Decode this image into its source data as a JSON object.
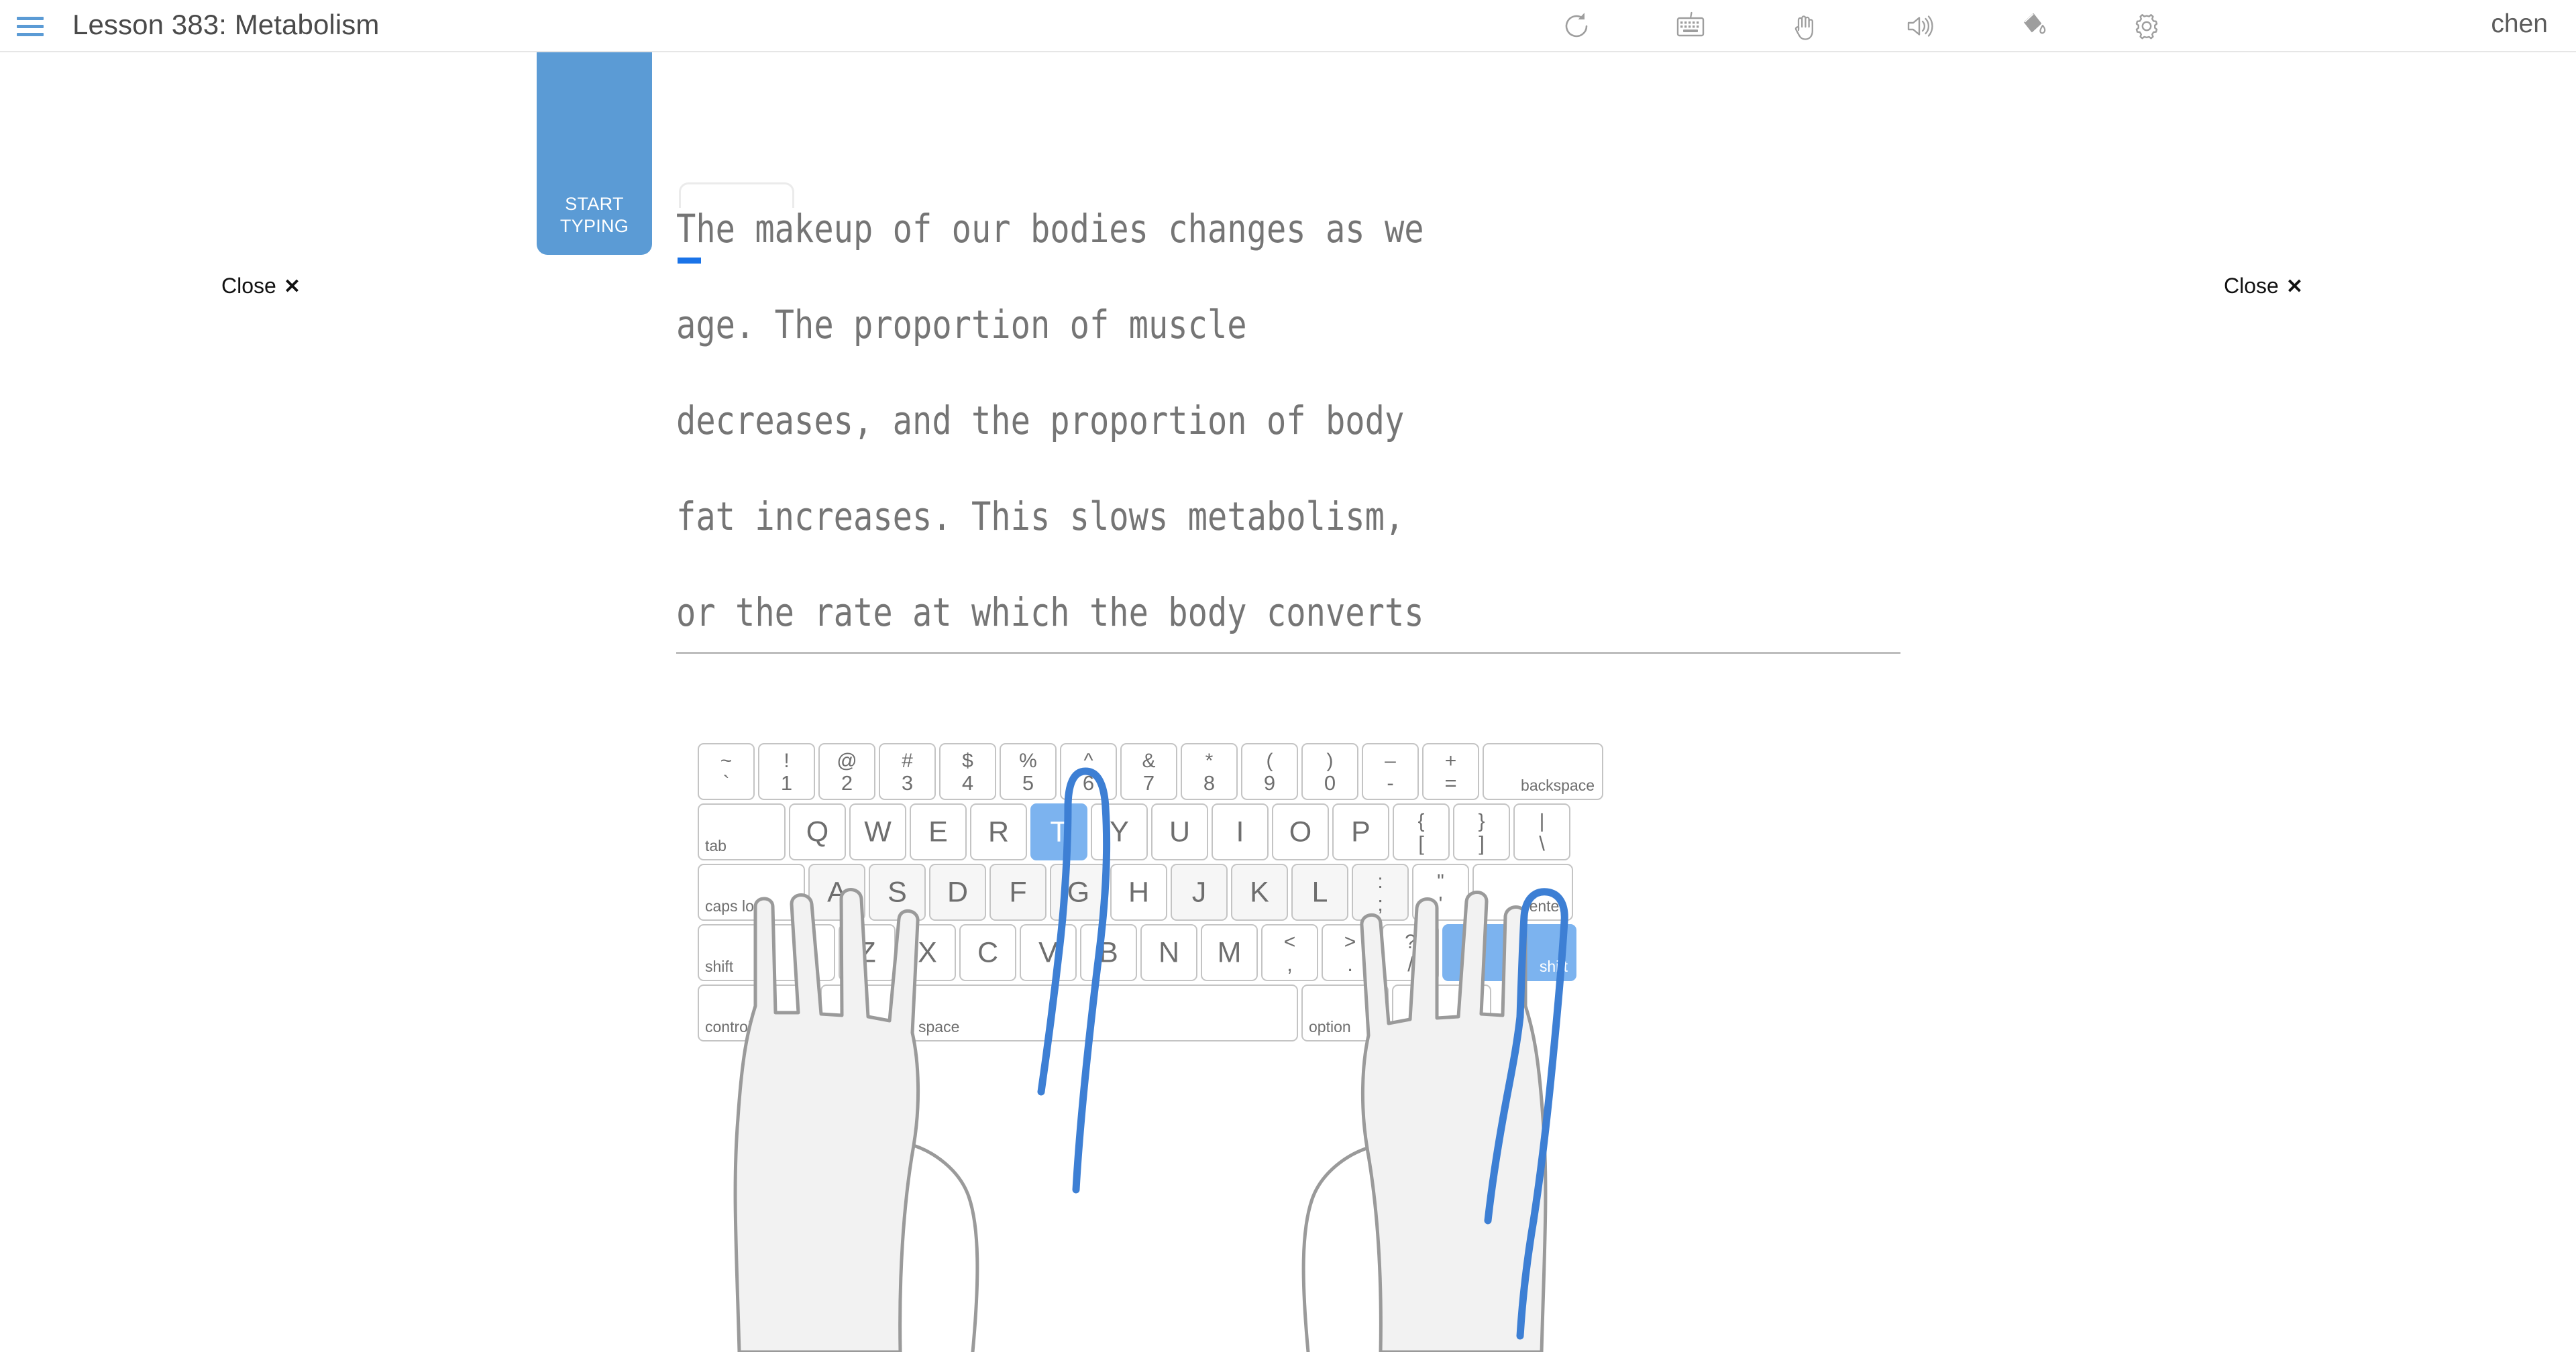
{
  "header": {
    "menu_icon": "hamburger-icon",
    "title": "Lesson 383: Metabolism",
    "username": "chen",
    "tools": [
      {
        "name": "restart-icon",
        "label": "restart"
      },
      {
        "name": "keyboard-icon",
        "label": "keyboard"
      },
      {
        "name": "hand-icon",
        "label": "hands"
      },
      {
        "name": "sound-icon",
        "label": "sound"
      },
      {
        "name": "paint-bucket-icon",
        "label": "theme"
      },
      {
        "name": "gear-icon",
        "label": "settings"
      }
    ]
  },
  "start_typing": {
    "line1": "START",
    "line2": "TYPING"
  },
  "close_buttons": {
    "label": "Close",
    "glyph": "✕"
  },
  "typing": {
    "full_text": "The makeup of our bodies changes as we age. The proportion of muscle decreases, and the proportion of body fat increases. This slows metabolism, or the rate at which the body converts",
    "lines": [
      "The makeup of our bodies changes as we",
      "age. The proportion of muscle",
      "decreases, and the proportion of body",
      "fat increases. This slows metabolism,",
      "or the rate at which the body converts"
    ],
    "cursor_index": 0,
    "cursor_char": "T"
  },
  "colors": {
    "accent_blue": "#5b9bd5",
    "key_highlight": "#7cb3ef",
    "cursor_blue": "#1a73e8",
    "text_gray": "#757575",
    "finger_guide_blue": "#3d7fd4",
    "hand_outline": "#9a9a9a"
  },
  "keyboard": {
    "active_keys": [
      "T",
      "shift-right"
    ],
    "home_keys": [
      "A",
      "S",
      "D",
      "F",
      "G",
      "H",
      "J",
      "K",
      "L",
      ";"
    ],
    "rows": [
      {
        "id": "number-row",
        "keys": [
          {
            "type": "dual",
            "upper": "~",
            "lower": "`",
            "name": "key-backtick"
          },
          {
            "type": "dual",
            "upper": "!",
            "lower": "1",
            "name": "key-1"
          },
          {
            "type": "dual",
            "upper": "@",
            "lower": "2",
            "name": "key-2"
          },
          {
            "type": "dual",
            "upper": "#",
            "lower": "3",
            "name": "key-3"
          },
          {
            "type": "dual",
            "upper": "$",
            "lower": "4",
            "name": "key-4"
          },
          {
            "type": "dual",
            "upper": "%",
            "lower": "5",
            "name": "key-5"
          },
          {
            "type": "dual",
            "upper": "^",
            "lower": "6",
            "name": "key-6"
          },
          {
            "type": "dual",
            "upper": "&",
            "lower": "7",
            "name": "key-7"
          },
          {
            "type": "dual",
            "upper": "*",
            "lower": "8",
            "name": "key-8"
          },
          {
            "type": "dual",
            "upper": "(",
            "lower": "9",
            "name": "key-9"
          },
          {
            "type": "dual",
            "upper": ")",
            "lower": "0",
            "name": "key-0"
          },
          {
            "type": "dual",
            "upper": "–",
            "lower": "-",
            "name": "key-minus"
          },
          {
            "type": "dual",
            "upper": "+",
            "lower": "=",
            "name": "key-equals"
          },
          {
            "type": "mod",
            "label": "backspace",
            "align": "right",
            "width": "w-back",
            "name": "key-backspace"
          }
        ]
      },
      {
        "id": "top-row",
        "keys": [
          {
            "type": "mod",
            "label": "tab",
            "align": "left",
            "width": "w-tab",
            "name": "key-tab"
          },
          {
            "type": "letter",
            "glyph": "Q",
            "name": "key-q"
          },
          {
            "type": "letter",
            "glyph": "W",
            "name": "key-w"
          },
          {
            "type": "letter",
            "glyph": "E",
            "name": "key-e"
          },
          {
            "type": "letter",
            "glyph": "R",
            "name": "key-r"
          },
          {
            "type": "letter",
            "glyph": "T",
            "name": "key-t",
            "active": true
          },
          {
            "type": "letter",
            "glyph": "Y",
            "name": "key-y"
          },
          {
            "type": "letter",
            "glyph": "U",
            "name": "key-u"
          },
          {
            "type": "letter",
            "glyph": "I",
            "name": "key-i"
          },
          {
            "type": "letter",
            "glyph": "O",
            "name": "key-o"
          },
          {
            "type": "letter",
            "glyph": "P",
            "name": "key-p"
          },
          {
            "type": "dual",
            "upper": "{",
            "lower": "[",
            "name": "key-bracket-left"
          },
          {
            "type": "dual",
            "upper": "}",
            "lower": "]",
            "name": "key-bracket-right"
          },
          {
            "type": "dual",
            "upper": "|",
            "lower": "\\",
            "name": "key-backslash"
          }
        ]
      },
      {
        "id": "home-row",
        "keys": [
          {
            "type": "mod",
            "label": "caps lock",
            "align": "left",
            "width": "w-caps",
            "name": "key-caps-lock"
          },
          {
            "type": "letter",
            "glyph": "A",
            "name": "key-a",
            "home": true
          },
          {
            "type": "letter",
            "glyph": "S",
            "name": "key-s",
            "home": true
          },
          {
            "type": "letter",
            "glyph": "D",
            "name": "key-d",
            "home": true
          },
          {
            "type": "letter",
            "glyph": "F",
            "name": "key-f",
            "home": true
          },
          {
            "type": "letter",
            "glyph": "G",
            "name": "key-g",
            "home": true
          },
          {
            "type": "letter",
            "glyph": "H",
            "name": "key-h"
          },
          {
            "type": "letter",
            "glyph": "J",
            "name": "key-j",
            "home": true
          },
          {
            "type": "letter",
            "glyph": "K",
            "name": "key-k",
            "home": true
          },
          {
            "type": "letter",
            "glyph": "L",
            "name": "key-l",
            "home": true
          },
          {
            "type": "dual",
            "upper": ":",
            "lower": ";",
            "name": "key-semicolon",
            "home": true
          },
          {
            "type": "dual",
            "upper": "\"",
            "lower": "'",
            "name": "key-quote"
          },
          {
            "type": "mod",
            "label": "enter",
            "align": "right",
            "width": "w-enter",
            "name": "key-enter"
          }
        ]
      },
      {
        "id": "bottom-letter-row",
        "keys": [
          {
            "type": "mod",
            "label": "shift",
            "align": "left",
            "width": "w-shiftL",
            "name": "key-shift-left"
          },
          {
            "type": "letter",
            "glyph": "Z",
            "name": "key-z"
          },
          {
            "type": "letter",
            "glyph": "X",
            "name": "key-x"
          },
          {
            "type": "letter",
            "glyph": "C",
            "name": "key-c"
          },
          {
            "type": "letter",
            "glyph": "V",
            "name": "key-v"
          },
          {
            "type": "letter",
            "glyph": "B",
            "name": "key-b"
          },
          {
            "type": "letter",
            "glyph": "N",
            "name": "key-n"
          },
          {
            "type": "letter",
            "glyph": "M",
            "name": "key-m"
          },
          {
            "type": "dual",
            "upper": "<",
            "lower": ",",
            "name": "key-comma"
          },
          {
            "type": "dual",
            "upper": ">",
            "lower": ".",
            "name": "key-period"
          },
          {
            "type": "dual",
            "upper": "?",
            "lower": "/",
            "name": "key-slash"
          },
          {
            "type": "mod",
            "label": "shift",
            "align": "right",
            "width": "w-shiftR",
            "name": "key-shift-right",
            "active": true
          }
        ]
      },
      {
        "id": "modifier-row",
        "keys": [
          {
            "type": "mod",
            "label": "control",
            "align": "left",
            "width": "w-ctrl",
            "name": "key-control"
          },
          {
            "type": "mod",
            "label": "option",
            "align": "left",
            "width": "w-opt",
            "name": "key-option-left"
          },
          {
            "type": "mod",
            "label": "space",
            "align": "left",
            "width": "w-space",
            "name": "key-space"
          },
          {
            "type": "mod",
            "label": "option",
            "align": "left",
            "width": "w-opt2",
            "name": "key-option-right"
          },
          {
            "type": "mod",
            "label": "",
            "align": "left",
            "width": "w-last",
            "name": "key-command-right"
          }
        ]
      }
    ]
  }
}
